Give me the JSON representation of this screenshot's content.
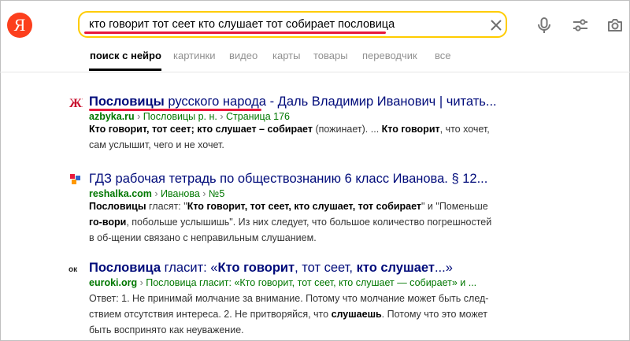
{
  "search": {
    "query": "кто говорит тот сеет кто слушает тот собирает пословица",
    "logo_letter": "Я"
  },
  "icons": {
    "clear": "close-icon",
    "voice": "microphone-icon",
    "filters": "sliders-icon",
    "camera": "camera-icon"
  },
  "tabs": [
    "поиск с нейро",
    "картинки",
    "видео",
    "карты",
    "товары",
    "переводчик",
    "все"
  ],
  "results": [
    {
      "title_bold": "Пословицы",
      "title_rest": " русского народа - Даль Владимир Иванович | читать...",
      "url_domain": "azbyka.ru",
      "url_path": [
        " Пословицы р. н. ",
        " Страница 176"
      ],
      "snippet_b1": "Кто говорит, тот сеет; кто слушает – собирает",
      "snippet_t1": " (пожинает). ... ",
      "snippet_b2": "Кто говорит",
      "snippet_t2": ", что хочет, сам услышит, чего и не хочет."
    },
    {
      "title": "ГДЗ рабочая тетрадь по обществознанию 6 класс Иванова. § 12...",
      "url_domain": "reshalka.com",
      "url_path": [
        " Иванова ",
        " №5"
      ],
      "snippet_b1": "Пословицы",
      "snippet_t1": " гласят: \"",
      "snippet_b2": "Кто говорит, тот сеет, кто слушает, тот собирает",
      "snippet_t2": "\" и \"Поменьше ",
      "snippet_b3": "го-вори",
      "snippet_t3": ", побольше услышишь\". Из них следует, что большое количество погрешностей в об-щении связано с неправильным слушанием."
    },
    {
      "title_bold1": "Пословица",
      "title_rest1": " гласит: «",
      "title_bold2": "Кто говорит",
      "title_rest2": ", тот сеет, ",
      "title_bold3": "кто слушает",
      "title_rest3": "...»",
      "url_domain": "euroki.org",
      "url_path": [
        " Пословица гласит: «Кто говорит, тот сеет, кто слушает — собирает» и ..."
      ],
      "snippet_t1": "Ответ: 1. Не принимай молчание за внимание. Потому что молчание может быть след-ствием отсутствия интереса. 2. Не притворяйся, что ",
      "snippet_b1": "слушаешь",
      "snippet_t2": ". Потому что это может быть воспринято как неуважение."
    }
  ]
}
